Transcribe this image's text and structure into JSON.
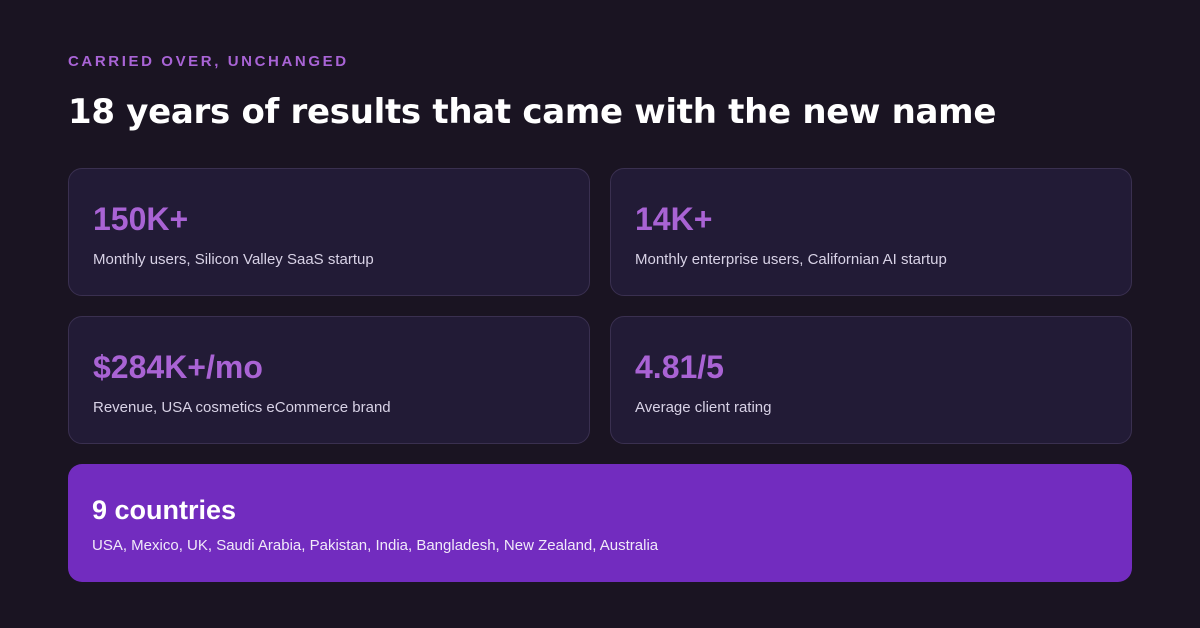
{
  "header": {
    "eyebrow": "CARRIED OVER, UNCHANGED",
    "title": "18 years of results that came with the new name"
  },
  "stats": [
    {
      "value": "150K+",
      "label": "Monthly users, Silicon Valley SaaS startup"
    },
    {
      "value": "14K+",
      "label": "Monthly enterprise users, Californian AI startup"
    },
    {
      "value": "$284K+/mo",
      "label": "Revenue, USA cosmetics eCommerce brand"
    },
    {
      "value": "4.81/5",
      "label": "Average client rating"
    }
  ],
  "countries": {
    "value": "9 countries",
    "label": "USA, Mexico, UK, Saudi Arabia, Pakistan, India, Bangladesh, New Zealand, Australia"
  },
  "colors": {
    "background": "#1a1422",
    "card": "#221b36",
    "accent": "#a963d4",
    "highlight_card": "#722cbf"
  }
}
